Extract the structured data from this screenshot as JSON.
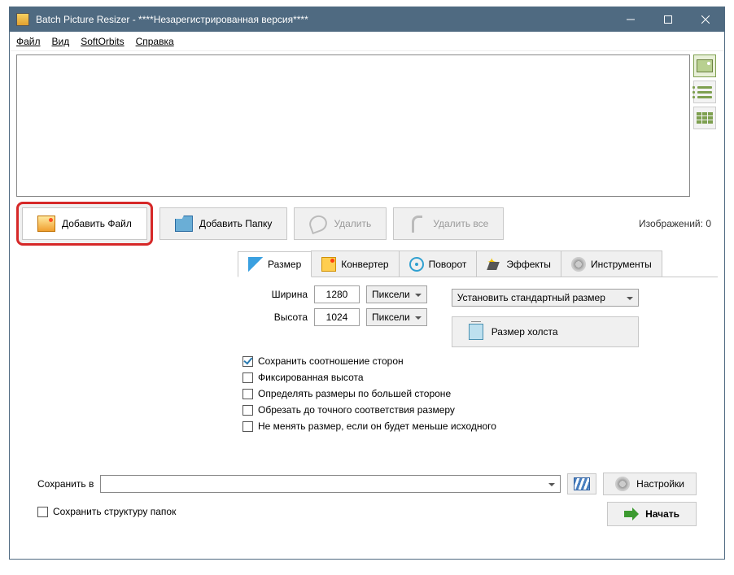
{
  "window": {
    "title": "Batch Picture Resizer - ****Незарегистрированная версия****"
  },
  "menu": {
    "file": "Файл",
    "view": "Вид",
    "softorbits": "SoftOrbits",
    "help": "Справка"
  },
  "toolbar": {
    "add_file": "Добавить Файл",
    "add_folder": "Добавить Папку",
    "delete": "Удалить",
    "delete_all": "Удалить все",
    "image_count_label": "Изображений:",
    "image_count_value": "0"
  },
  "tabs": {
    "size": "Размер",
    "converter": "Конвертер",
    "rotate": "Поворот",
    "effects": "Эффекты",
    "tools": "Инструменты"
  },
  "size_tab": {
    "width_label": "Ширина",
    "width_value": "1280",
    "height_label": "Высота",
    "height_value": "1024",
    "unit_width": "Пиксели",
    "unit_height": "Пиксели",
    "std_size": "Установить стандартный размер",
    "canvas_size": "Размер холста",
    "chk_aspect": "Сохранить соотношение сторон",
    "chk_fixed_h": "Фиксированная высота",
    "chk_bigger": "Определять размеры по большей стороне",
    "chk_crop": "Обрезать до точного соответствия размеру",
    "chk_noshrink": "Не менять размер, если он будет меньше исходного"
  },
  "bottom": {
    "save_in": "Сохранить в",
    "settings": "Настройки",
    "keep_structure": "Сохранить структуру папок",
    "start": "Начать"
  }
}
